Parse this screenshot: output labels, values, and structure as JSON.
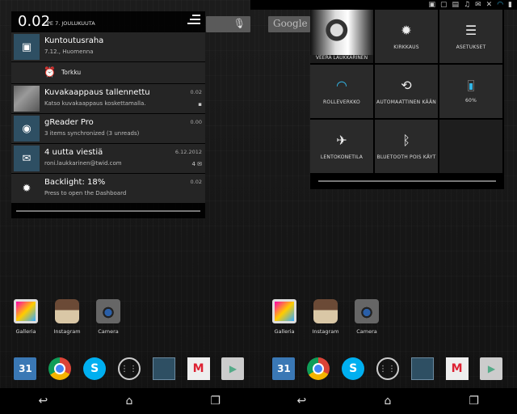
{
  "status_bar": {
    "icons": [
      "bluetooth-off-icon",
      "wifi-icon",
      "battery-icon"
    ],
    "notification_icons": [
      "calendar-icon",
      "screenshot-icon",
      "image-icon",
      "reader-icon",
      "mail-icon"
    ]
  },
  "left": {
    "search": {
      "placeholder": ""
    },
    "shade": {
      "time": "0.02",
      "date": "PE 7. JOULUKUUTA",
      "notifications": [
        {
          "title": "Kuntoutusraha",
          "subtitle": "7.12., Huomenna",
          "time": "",
          "meta": "",
          "icon": "calendar-icon"
        },
        {
          "title": "Kuvakaappaus tallennettu",
          "subtitle": "Katso kuvakaappaus koskettamalla.",
          "time": "0.02",
          "meta": "",
          "icon": "screenshot-thumbnail"
        },
        {
          "title": "gReader Pro",
          "subtitle": "3 items synchronized (3 unreads)",
          "time": "0.00",
          "meta": "",
          "icon": "rss-icon"
        },
        {
          "title": "4 uutta viestiä",
          "subtitle": "roni.laukkarinen@twid.com",
          "time": "6.12.2012",
          "meta": "4",
          "icon": "email-icon"
        },
        {
          "title": "Backlight: 18%",
          "subtitle": "Press to open the Dashboard",
          "time": "0.02",
          "meta": "",
          "icon": "brightness-icon"
        }
      ],
      "snooze_label": "Torkku"
    },
    "apps": [
      {
        "label": "Galleria"
      },
      {
        "label": "Instagram"
      },
      {
        "label": "Camera"
      }
    ]
  },
  "right": {
    "search": {
      "google_label": "Google"
    },
    "quick_settings": {
      "profile_name": "VEERA LAUKKARINEN",
      "brightness": "KIRKKAUS",
      "settings": "ASETUKSET",
      "wifi": "ROLLEVERKKO",
      "auto_rotate": "AUTOMAATTINEN KÄÄN",
      "battery": "60%",
      "airplane": "LENTOKONETILA",
      "bluetooth": "BLUETOOTH POIS KÄYT"
    },
    "apps": [
      {
        "label": "Galleria"
      },
      {
        "label": "Instagram"
      },
      {
        "label": "Camera"
      }
    ]
  },
  "dock": {
    "calendar_day": "31"
  },
  "colors": {
    "accent": "#33b5e5",
    "notif_icon_bg": "#2e4f63"
  }
}
